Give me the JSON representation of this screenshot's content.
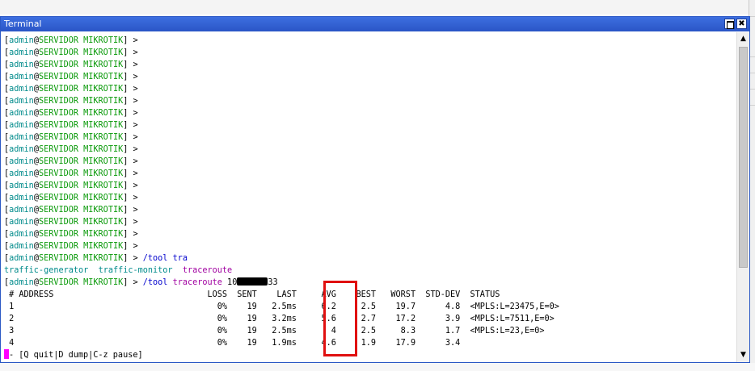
{
  "window": {
    "title": "Terminal",
    "restore_icon": "restore-icon",
    "close_glyph": "✖"
  },
  "terminal": {
    "prompt_user": "admin",
    "prompt_host": "SERVIDOR MIKROTIK",
    "prompt_end": "] >",
    "cmd1": " /tool tra",
    "completions": [
      "traffic-generator",
      "traffic-monitor",
      "traceroute"
    ],
    "cmd2_prefix": " /tool ",
    "cmd2_word": "traceroute",
    "cmd2_addr_start": " 10",
    "cmd2_addr_end": "33",
    "table_header": " # ADDRESS                               LOSS  SENT    LAST     AVG    BEST   WORST  STD-DEV  STATUS",
    "rows": [
      " 1                                         0%    19   2.5ms     6.2     2.5    19.7      4.8  <MPLS:L=23475,E=0>",
      " 2                                         0%    19   3.2ms     5.6     2.7    17.2      3.9  <MPLS:L=7511,E=0>",
      " 3                                         0%    19   2.5ms       4     2.5     8.3      1.7  <MPLS:L=23,E=0>",
      " 4                                         0%    19   1.9ms     4.6     1.9    17.9      3.4"
    ],
    "footer": "- [Q quit|D dump|C-z pause]"
  },
  "colors": {
    "titlebar": "#2a55c6",
    "prompt_user": "#008b8b",
    "prompt_host": "#0a9a0a",
    "command": "#0000cd",
    "highlight": "#e01010",
    "cursor": "#ff00ff"
  }
}
